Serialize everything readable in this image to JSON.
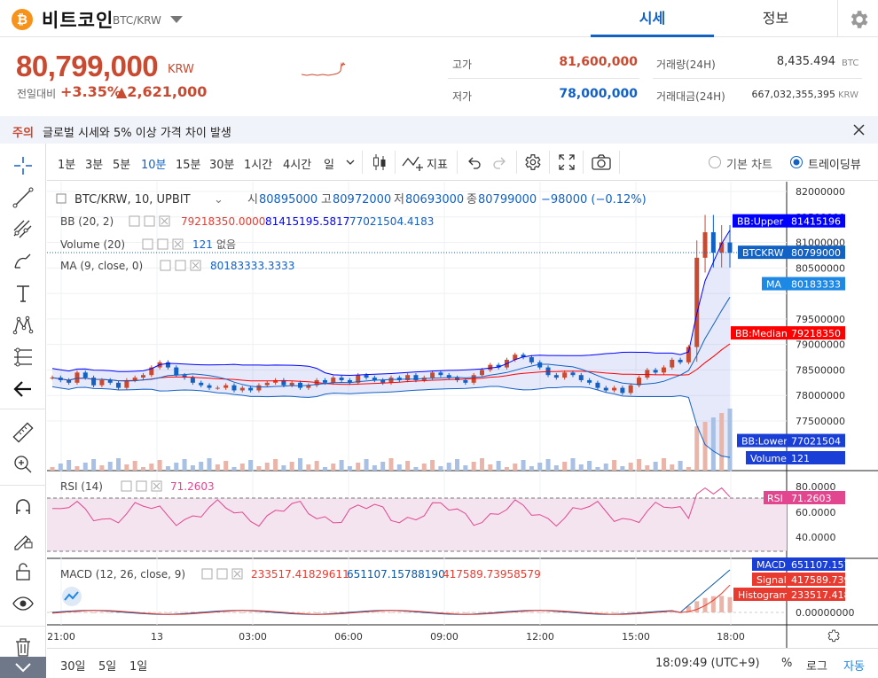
{
  "header": {
    "coin_symbol": "₿",
    "coin_name": "비트코인",
    "pair": "BTC/KRW",
    "tabs": [
      {
        "label": "시세"
      },
      {
        "label": "정보"
      }
    ]
  },
  "price": {
    "current": "80,799,000",
    "unit": "KRW",
    "change_label": "전일대비",
    "change_rate": "+3.35%",
    "change_amount": "▲2,621,000"
  },
  "stats": {
    "high_label": "고가",
    "high": "81,600,000",
    "low_label": "저가",
    "low": "78,000,000",
    "volume_label": "거래량(24H)",
    "volume": "8,435.494",
    "volume_unit": "BTC",
    "value_label": "거래대금(24H)",
    "value": "667,032,355,395",
    "value_unit": "KRW"
  },
  "notice": {
    "tag": "주의",
    "text": "글로벌 시세와 5% 이상 가격 차이 발생"
  },
  "toolbar": {
    "intervals": [
      "1분",
      "3분",
      "5분",
      "10분",
      "15분",
      "30분",
      "1시간",
      "4시간",
      "일"
    ],
    "active_interval": "10분",
    "indicators_label": "지표",
    "view_basic": "기본 차트",
    "view_tv": "트레이딩뷰"
  },
  "legend": {
    "symbol": "BTC/KRW, 10, UPBIT",
    "o_label": "시",
    "o": "80895000",
    "h_label": "고",
    "h": "80972000",
    "l_label": "저",
    "l": "80693000",
    "c_label": "종",
    "c": "80799000",
    "chg": "−98000 (−0.12%)",
    "bb_label": "BB (20, 2)",
    "bb_mid": "79218350.0000",
    "bb_up": "81415195.5817",
    "bb_low": "77021504.4183",
    "vol_label": "Volume (20)",
    "vol": "121",
    "vol_ma": "없음",
    "ma_label": "MA (9, close, 0)",
    "ma": "80183333.3333",
    "rsi_label": "RSI (14)",
    "rsi": "71.2603",
    "macd_label": "MACD (12, 26, close, 9)",
    "macd_hist": "233517.41829611",
    "macd": "651107.15788190",
    "macd_signal": "417589.73958579"
  },
  "price_axis": {
    "labels": [
      "82000000",
      "81500000",
      "81000000",
      "80500000",
      "79500000",
      "79000000",
      "78500000",
      "78000000",
      "77500000"
    ],
    "tags": [
      {
        "name": "BB:Upper",
        "value": "81415196"
      },
      {
        "name": "BTCKRW",
        "value": "80799000"
      },
      {
        "name": "MA",
        "value": "80183333"
      },
      {
        "name": "BB:Median",
        "value": "79218350"
      },
      {
        "name": "BB:Lower",
        "value": "77021504"
      },
      {
        "name": "Volume",
        "value": "121"
      }
    ]
  },
  "rsi_axis": {
    "labels": [
      "80.0000",
      "60.0000",
      "40.0000"
    ],
    "tag_name": "RSI",
    "tag_value": "71.2603"
  },
  "macd_axis": {
    "labels": [
      "0.00000000"
    ],
    "tags": [
      {
        "name": "MACD",
        "value": "651107.15788190"
      },
      {
        "name": "Signal",
        "value": "417589.73958579"
      },
      {
        "name": "Histogram",
        "value": "233517.41829611"
      }
    ]
  },
  "time_axis": [
    "21:00",
    "13",
    "03:00",
    "06:00",
    "09:00",
    "12:00",
    "15:00",
    "18:00"
  ],
  "bottom": {
    "ranges": [
      "30일",
      "5일",
      "1일"
    ],
    "clock": "18:09:49 (UTC+9)",
    "percent": "%",
    "log": "로그",
    "auto": "자동"
  },
  "colors": {
    "up": "#c84a31",
    "down": "#1261c4",
    "bb_upper": "#0000ff",
    "bb_lower": "#1261c4",
    "bb_median": "#ff0000",
    "ma": "#1261c4",
    "rsi": "#e2468f",
    "macd": "#0a58a5",
    "signal": "#e83a2f"
  },
  "chart_data": {
    "type": "candlestick",
    "symbol": "BTC/KRW",
    "interval": "10",
    "exchange": "UPBIT",
    "ylim": [
      77000000,
      82200000
    ],
    "last": {
      "open": 80895000,
      "high": 80972000,
      "low": 80693000,
      "close": 80799000,
      "volume": 121
    },
    "bollinger": {
      "upper": 81415195.5817,
      "median": 79218350.0,
      "lower": 77021504.4183
    },
    "ma9": 80183333.3333,
    "rsi14": 71.2603,
    "macd": {
      "macd": 651107.1578819,
      "signal": 417589.73958579,
      "histogram": 233517.41829611
    },
    "close_trend": [
      78350000,
      78300000,
      78250000,
      78450000,
      78350000,
      78200000,
      78300000,
      78250000,
      78150000,
      78300000,
      78350000,
      78400000,
      78550000,
      78650000,
      78550000,
      78400000,
      78350000,
      78250000,
      78200000,
      78150000,
      78150000,
      78200000,
      78100000,
      78150000,
      78100000,
      78200000,
      78250000,
      78300000,
      78200000,
      78250000,
      78150000,
      78200000,
      78300000,
      78250000,
      78350000,
      78300000,
      78250000,
      78400000,
      78350000,
      78300000,
      78250000,
      78350000,
      78300000,
      78400000,
      78300000,
      78350000,
      78450000,
      78400000,
      78350000,
      78300000,
      78250000,
      78400000,
      78500000,
      78600000,
      78550000,
      78700000,
      78800000,
      78750000,
      78650000,
      78550000,
      78400000,
      78350000,
      78450000,
      78400000,
      78300000,
      78250000,
      78150000,
      78100000,
      78150000,
      78050000,
      78200000,
      78350000,
      78500000,
      78450000,
      78550000,
      78700000,
      78650000,
      78950000,
      80700000,
      81200000,
      80800000,
      81000000,
      80799000
    ]
  }
}
